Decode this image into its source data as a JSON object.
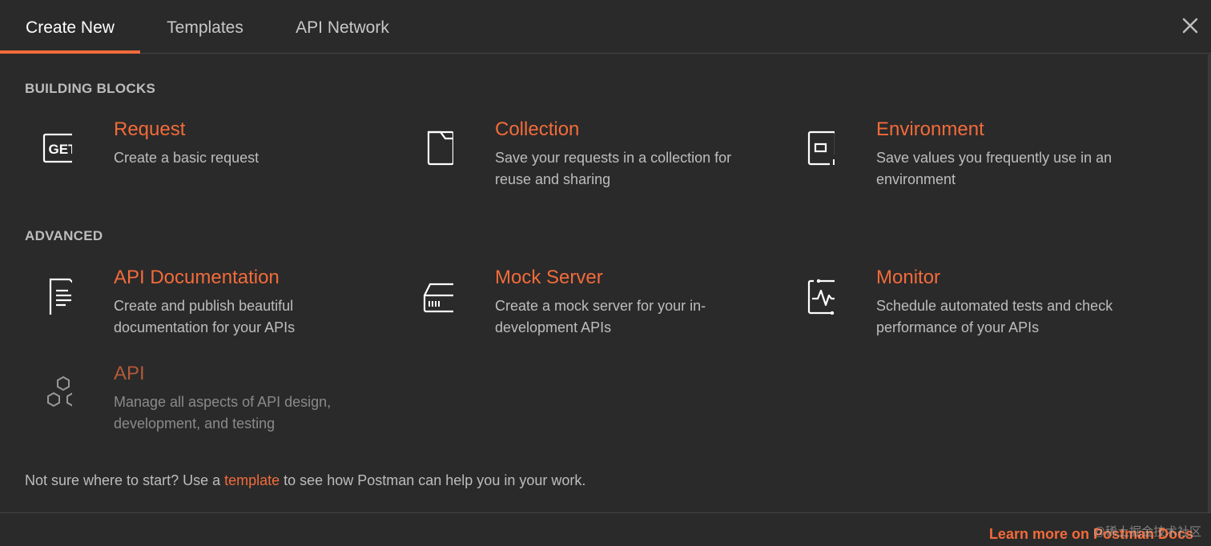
{
  "tabs": [
    {
      "label": "Create New",
      "active": true
    },
    {
      "label": "Templates",
      "active": false
    },
    {
      "label": "API Network",
      "active": false
    }
  ],
  "sections": {
    "building_blocks": "BUILDING BLOCKS",
    "advanced": "ADVANCED"
  },
  "cards": {
    "request": {
      "title": "Request",
      "desc": "Create a basic request",
      "icon": "get-request-icon"
    },
    "collection": {
      "title": "Collection",
      "desc": "Save your requests in a collection for reuse and sharing",
      "icon": "folder-icon"
    },
    "environment": {
      "title": "Environment",
      "desc": "Save values you frequently use in an environment",
      "icon": "environment-icon"
    },
    "api_documentation": {
      "title": "API Documentation",
      "desc": "Create and publish beautiful documentation for your APIs",
      "icon": "document-icon"
    },
    "mock_server": {
      "title": "Mock Server",
      "desc": "Create a mock server for your in-development APIs",
      "icon": "server-icon"
    },
    "monitor": {
      "title": "Monitor",
      "desc": "Schedule automated tests and check performance of your APIs",
      "icon": "monitor-icon"
    },
    "api": {
      "title": "API",
      "desc": "Manage all aspects of API design, development, and testing",
      "icon": "hexagons-icon"
    }
  },
  "hint": {
    "prefix": "Not sure where to start? Use a ",
    "link": "template",
    "suffix": " to see how Postman can help you in your work."
  },
  "footer": {
    "learn_more": "Learn more on Postman Docs",
    "watermark": "@稀土掘金技术社区"
  },
  "colors": {
    "accent": "#f26b3a",
    "background": "#2a2a2a",
    "text": "#bdbdbd"
  }
}
